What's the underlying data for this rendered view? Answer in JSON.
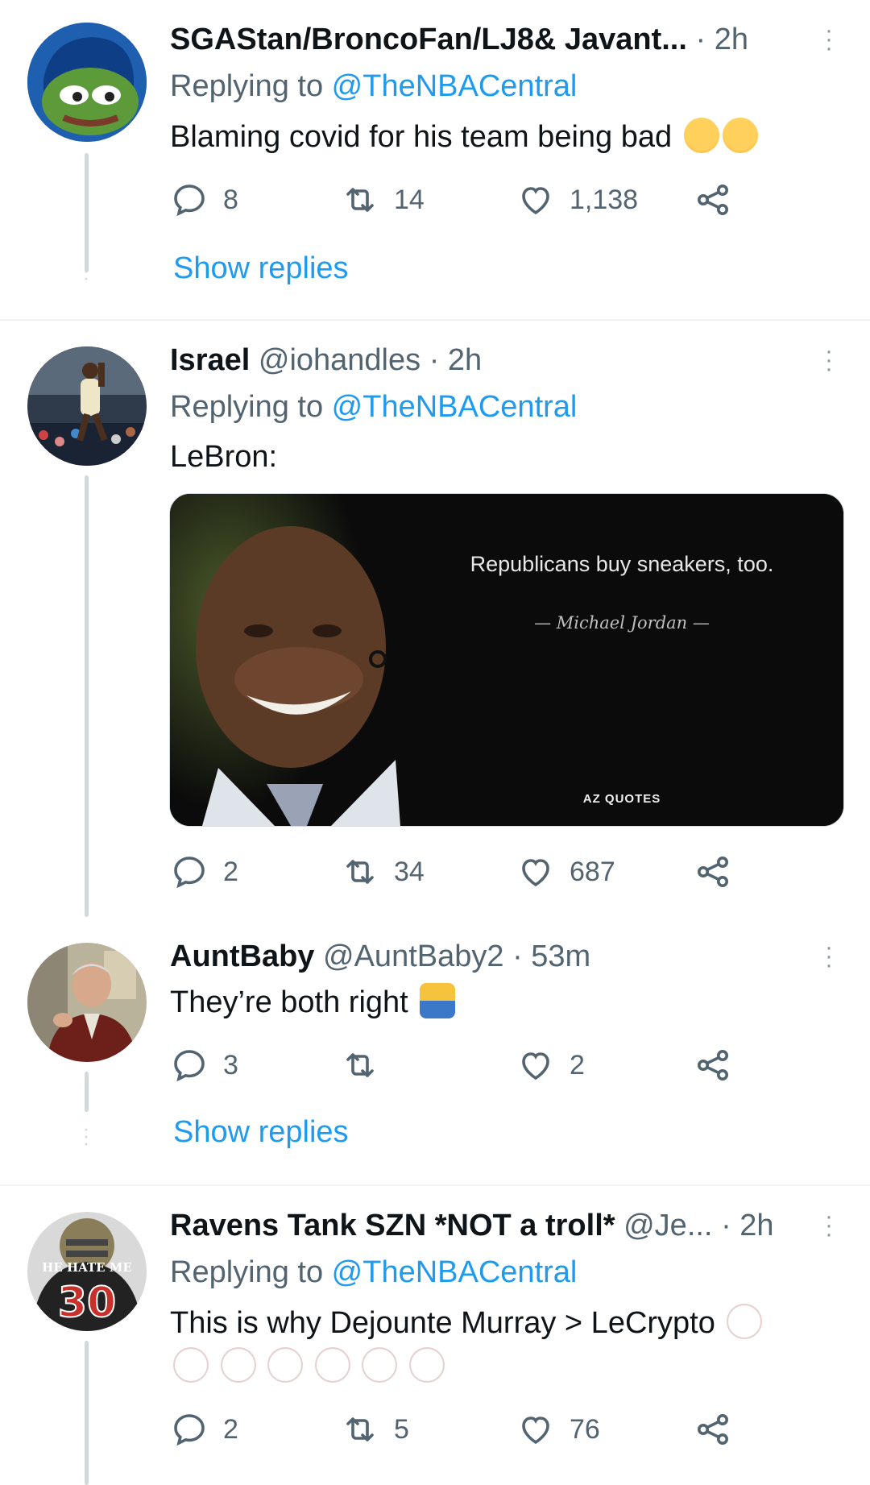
{
  "tweets": [
    {
      "display_name": "SGAStan/BroncoFan/LJ8& Javant...",
      "handle": "",
      "time": "· 2h",
      "replying_prefix": "Replying to ",
      "replying_to": "@TheNBACentral",
      "text": "Blaming covid for his team being bad",
      "emojis": [
        "loudly-crying-face",
        "loudly-crying-face"
      ],
      "replies": "8",
      "retweets": "14",
      "likes": "1,138",
      "show_replies": "Show replies"
    },
    {
      "display_name": "Israel",
      "handle": "@iohandles",
      "time": "· 2h",
      "replying_prefix": "Replying to ",
      "replying_to": "@TheNBACentral",
      "text": "LeBron:",
      "media": {
        "quote": "Republicans buy sneakers, too.",
        "author": "— Michael Jordan —",
        "brand": "AZ QUOTES"
      },
      "replies": "2",
      "retweets": "34",
      "likes": "687"
    },
    {
      "display_name": "AuntBaby",
      "handle": "@AuntBaby2",
      "time": "· 53m",
      "text": "They’re both right",
      "emojis": [
        "person-shrugging"
      ],
      "replies": "3",
      "retweets": "",
      "likes": "2",
      "show_replies": "Show replies"
    },
    {
      "display_name": "Ravens Tank SZN *NOT a troll*",
      "handle": "@Je...",
      "time": "· 2h",
      "replying_prefix": "Replying to ",
      "replying_to": "@TheNBACentral",
      "text": "This is why Dejounte Murray > LeCrypto",
      "emojis": [
        "clown-face",
        "clown-face",
        "clown-face",
        "clown-face",
        "clown-face",
        "clown-face",
        "clown-face"
      ],
      "avatar_text": "HE HATE ME",
      "avatar_number": "30",
      "replies": "2",
      "retweets": "5",
      "likes": "76"
    }
  ],
  "colors": {
    "accent": "#1d9bf0",
    "muted": "#536471",
    "thread": "#cfd9de"
  }
}
